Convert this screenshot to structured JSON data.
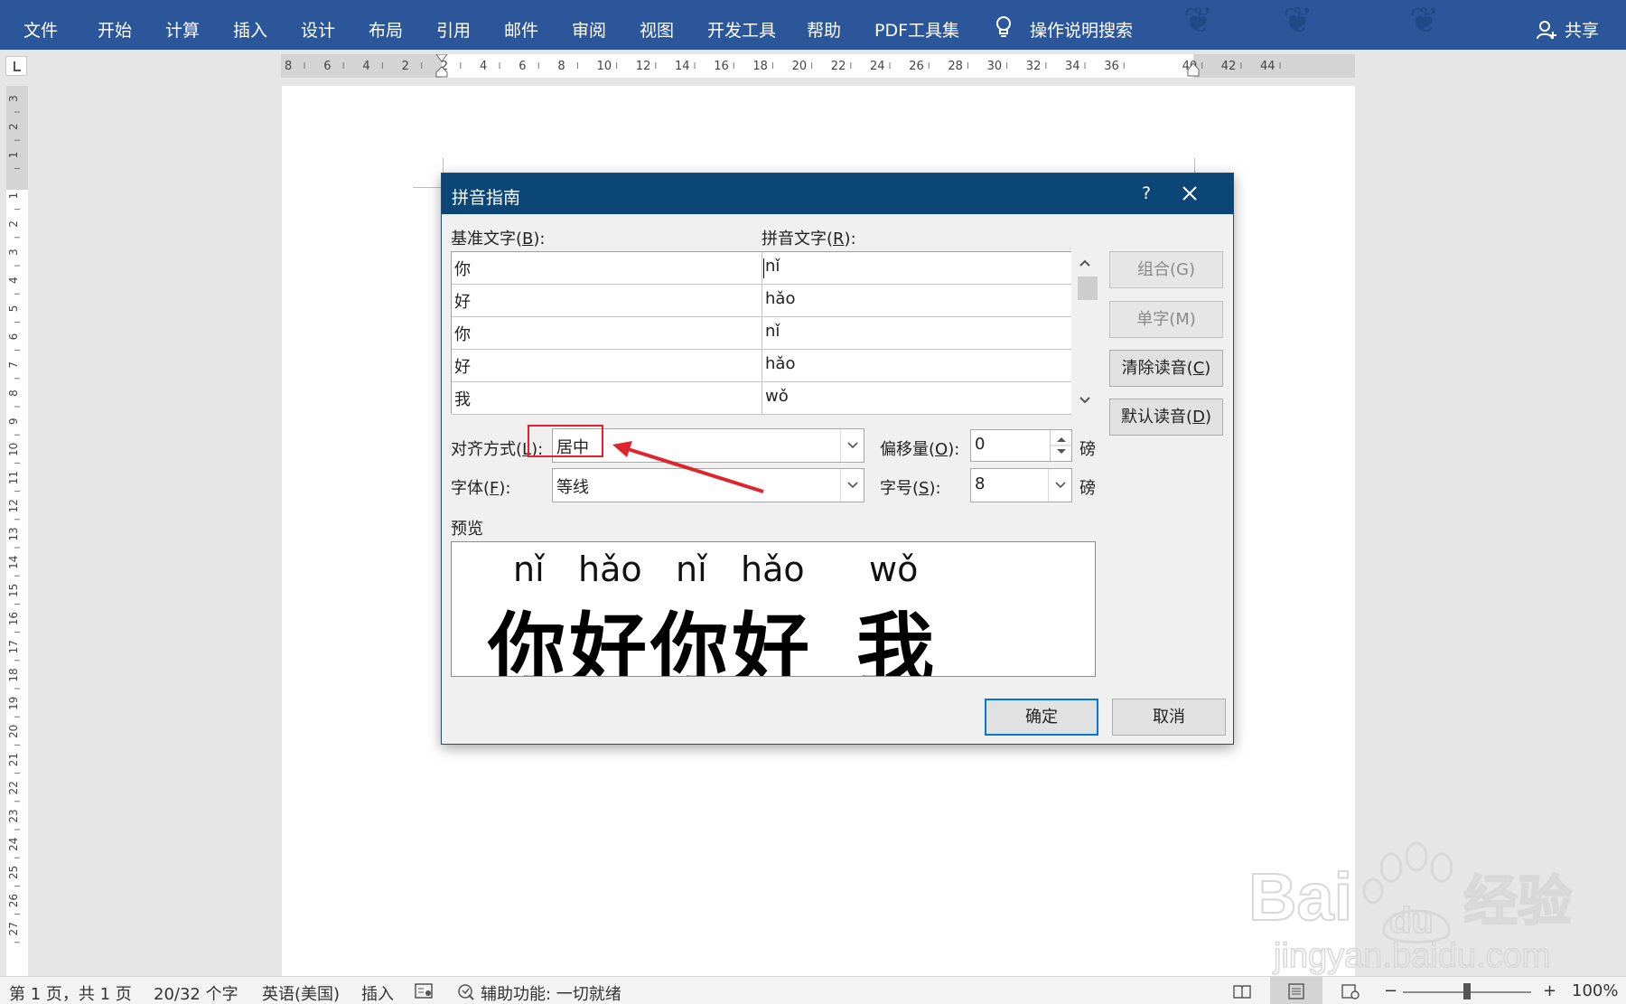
{
  "ribbon": {
    "tabs": [
      "文件",
      "开始",
      "计算",
      "插入",
      "设计",
      "布局",
      "引用",
      "邮件",
      "审阅",
      "视图",
      "开发工具",
      "帮助",
      "PDF工具集"
    ],
    "search_label": "操作说明搜索",
    "share_label": "共享"
  },
  "ruler": {
    "h_labels": [
      "8",
      "6",
      "4",
      "2",
      "2",
      "4",
      "6",
      "8",
      "10",
      "12",
      "14",
      "16",
      "18",
      "20",
      "22",
      "24",
      "26",
      "28",
      "30",
      "32",
      "34",
      "36",
      "40",
      "42",
      "44"
    ],
    "v_labels": [
      "3",
      "2",
      "1",
      "1",
      "2",
      "3",
      "4",
      "5",
      "6",
      "7",
      "8",
      "9",
      "10",
      "11",
      "12",
      "13",
      "14",
      "15",
      "16",
      "17",
      "18",
      "19",
      "20",
      "21",
      "22",
      "23",
      "24",
      "25",
      "26",
      "27"
    ]
  },
  "dialog": {
    "title": "拼音指南",
    "help": "?",
    "base_label": "基准文字",
    "base_key": "B",
    "ruby_label": "拼音文字",
    "ruby_key": "R",
    "rows": [
      {
        "base": "你",
        "ruby": "nǐ"
      },
      {
        "base": "好",
        "ruby": "hǎo"
      },
      {
        "base": "你",
        "ruby": "nǐ"
      },
      {
        "base": "好",
        "ruby": "hǎo"
      },
      {
        "base": "我",
        "ruby": "wǒ"
      }
    ],
    "buttons": {
      "group": "组合(G)",
      "mono": "单字(M)",
      "clear_text": "清除读音",
      "clear_key": "C",
      "default_text": "默认读音",
      "default_key": "D",
      "ok": "确定",
      "cancel": "取消"
    },
    "align_label": "对齐方式",
    "align_key": "L",
    "align_value": "居中",
    "offset_label": "偏移量",
    "offset_key": "O",
    "offset_value": "0",
    "font_label": "字体",
    "font_key": "F",
    "font_value": "等线",
    "size_label": "字号",
    "size_key": "S",
    "size_value": "8",
    "unit": "磅",
    "preview_label": "预览",
    "preview": {
      "pinyin": [
        "nǐ",
        "hǎo",
        "nǐ",
        "hǎo",
        "wǒ"
      ],
      "hanzi": [
        "你",
        "好",
        "你",
        "好",
        "我"
      ]
    }
  },
  "statusbar": {
    "page": "第 1 页，共 1 页",
    "words": "20/32 个字",
    "language": "英语(美国)",
    "mode": "插入",
    "accessibility": "辅助功能: 一切就绪",
    "zoom_minus": "−",
    "zoom_plus": "+",
    "zoom": "100%",
    "zoom_fraction": 0.5
  },
  "watermark": {
    "brand": "Bai",
    "brand2": "du",
    "cn": "经验",
    "url": "jingyan.baidu.com"
  },
  "colors": {
    "ribbon": "#2b579a",
    "dialog_title": "#0b4677",
    "highlight": "#e0242e"
  }
}
